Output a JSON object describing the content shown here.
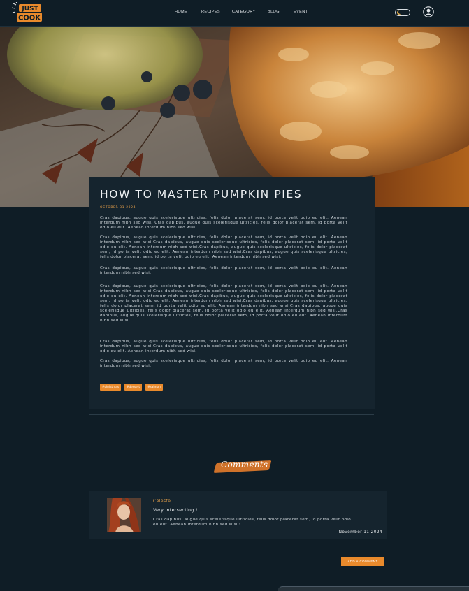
{
  "header": {
    "logo_text": "JUST COOK",
    "nav": [
      {
        "label": "HOME"
      },
      {
        "label": "RECIPES"
      },
      {
        "label": "CATEGORY"
      },
      {
        "label": "BLOG"
      },
      {
        "label": "EVENT"
      }
    ]
  },
  "article": {
    "title": "HOW TO MASTER PUMPKIN PIES",
    "date": "OCTOBER 31 2024",
    "paragraphs": [
      "Cras dapibus, augue quis scelerisque ultricies, felis dolor placerat sem, id porta velit odio eu elit. Aenean interdum nibh sed wisi. Cras dapibus, augue quis scelerisque ultricies, felis dolor placerat sem, id porta velit odio eu elit. Aenean interdum nibh sed wisi.",
      "Cras dapibus, augue quis scelerisque ultricies, felis dolor placerat sem, id porta velit odio eu elit. Aenean interdum nibh sed wisi.Cras dapibus, augue quis scelerisque ultricies, felis dolor placerat sem, id porta velit odio eu elit. Aenean interdum nibh sed wisi.Cras dapibus, augue quis scelerisque ultricies, felis dolor placerat sem, id porta velit odio eu elit. Aenean interdum nibh sed wisi.Cras dapibus, augue quis scelerisque ultricies, felis dolor placerat sem, id porta velit odio eu elit. Aenean interdum nibh sed wisi.",
      "Cras dapibus, augue quis scelerisque ultricies, felis dolor placerat sem, id porta velit odio eu elit. Aenean interdum nibh sed wisi.",
      "Cras dapibus, augue quis scelerisque ultricies, felis dolor placerat sem, id porta velit odio eu elit. Aenean interdum nibh sed wisi.Cras dapibus, augue quis scelerisque ultricies, felis dolor placerat sem, id porta velit odio eu elit. Aenean interdum nibh sed wisi.Cras dapibus, augue quis scelerisque ultricies, felis dolor placerat sem, id porta velit odio eu elit. Aenean interdum nibh sed wisi.Cras dapibus, augue quis scelerisque ultricies, felis dolor placerat sem, id porta velit odio eu elit. Aenean interdum nibh sed wisi.Cras dapibus, augue quis scelerisque ultricies, felis dolor placerat sem, id porta velit odio eu elit. Aenean interdum nibh sed wisi.Cras dapibus, augue quis scelerisque ultricies, felis dolor placerat sem, id porta velit odio eu elit. Aenean interdum nibh sed wisi.",
      "Cras dapibus, augue quis scelerisque ultricies, felis dolor placerat sem, id porta velit odio eu elit. Aenean interdum nibh sed wisi.Cras dapibus, augue quis scelerisque ultricies, felis dolor placerat sem, id porta velit odio eu elit. Aenean interdum nibh sed wisi.",
      "Cras dapibus, augue quis scelerisque ultricies, felis dolor placerat sem, id porta velit odio eu elit. Aenean interdum nibh sed wisi."
    ],
    "tags": [
      "#christmas",
      "#dessert",
      "#salmon"
    ]
  },
  "comments": {
    "title": "Comments",
    "items": [
      {
        "author": "Céleste",
        "heading": "Very intersecting !",
        "text": "Cras dapibus, augue quis scelerisque ultricies, felis dolor placerat sem, id porta velit odio eu elit. Aenean interdum nibh sed wisi !",
        "date": "November 11 2024"
      }
    ],
    "add_label": "ADD A COMMENT"
  },
  "colors": {
    "background": "#0f1d26",
    "card": "#15242e",
    "accent": "#e98a2c",
    "accent_text": "#e9a24a"
  }
}
